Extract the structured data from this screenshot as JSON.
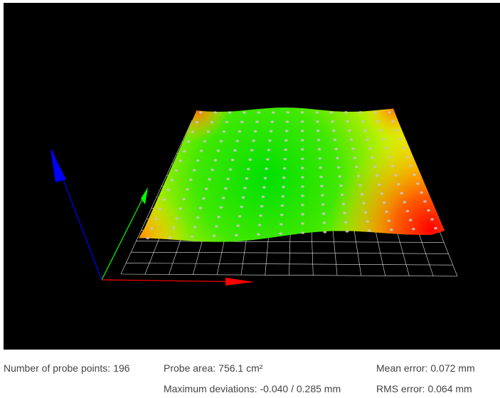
{
  "viewer": {
    "background": "#000000",
    "grid_color": "#ffffff",
    "probe_point_color": "#c8c8c8",
    "axis_colors": {
      "x": "#ff0000",
      "y": "#00ff00",
      "z": "#0000ff"
    },
    "heatmap_colors": [
      "#00e000",
      "#ffff00",
      "#ff0000"
    ],
    "probe_grid": {
      "rows": 14,
      "cols": 14
    }
  },
  "stats": {
    "probe_points_label": "Number of probe points:",
    "probe_points_value": "196",
    "probe_area_label": "Probe area:",
    "probe_area_value": "756.1 cm²",
    "mean_error_label": "Mean error:",
    "mean_error_value": "0.072 mm",
    "max_dev_label": "Maximum deviations:",
    "max_dev_value": "-0.040 / 0.285 mm",
    "rms_error_label": "RMS error:",
    "rms_error_value": "0.064 mm"
  }
}
